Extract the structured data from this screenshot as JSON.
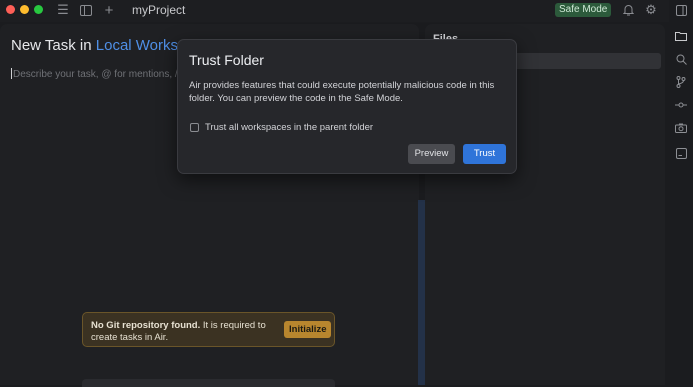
{
  "titlebar": {
    "project_name": "myProject",
    "safe_mode_label": "Safe Mode",
    "icons": [
      "sidebar-toggle-icon",
      "panel-icon",
      "plus-icon",
      "bell-icon",
      "gear-icon"
    ]
  },
  "task": {
    "title_prefix": "New Task in",
    "workspace_label": "Local Workspace",
    "input_placeholder": "Describe your task, @ for mentions, /"
  },
  "files_panel": {
    "title": "Files"
  },
  "git_warning": {
    "bold_text": "No Git repository found.",
    "text": "It is required to create tasks in Air.",
    "button_label": "Initialize"
  },
  "modal": {
    "title": "Trust Folder",
    "body": "Air provides features that could execute potentially malicious code in this folder. You can preview the code in the Safe Mode.",
    "checkbox_label": "Trust all workspaces in the parent folder",
    "checkbox_checked": false,
    "preview_label": "Preview",
    "trust_label": "Trust"
  },
  "sidebar": {
    "icons": [
      "folder-icon",
      "search-icon",
      "git-branch-icon",
      "git-commit-icon",
      "camera-icon",
      "terminal-icon",
      "layout-icon"
    ]
  },
  "colors": {
    "accent": "#2f74d9",
    "workspace_link": "#4f8fe6",
    "safe_mode_bg": "#2c5a3b",
    "warning_button": "#b8862e"
  }
}
